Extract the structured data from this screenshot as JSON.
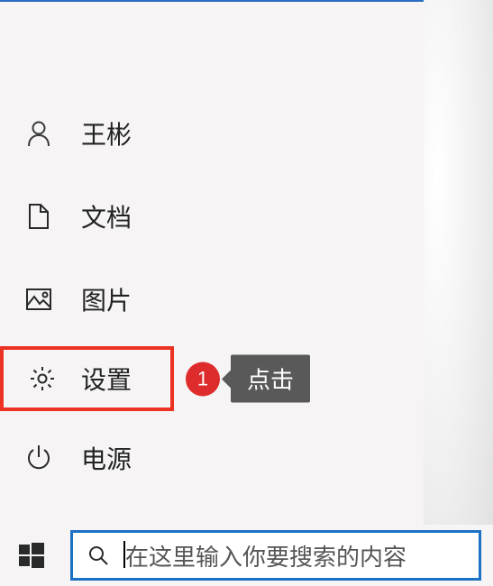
{
  "menu": {
    "user": {
      "label": "王彬"
    },
    "documents": {
      "label": "文档"
    },
    "pictures": {
      "label": "图片"
    },
    "settings": {
      "label": "设置"
    },
    "power": {
      "label": "电源"
    }
  },
  "annotation": {
    "badge_number": "1",
    "callout_text": "点击"
  },
  "taskbar": {
    "search_placeholder": "在这里输入你要搜索的内容"
  }
}
